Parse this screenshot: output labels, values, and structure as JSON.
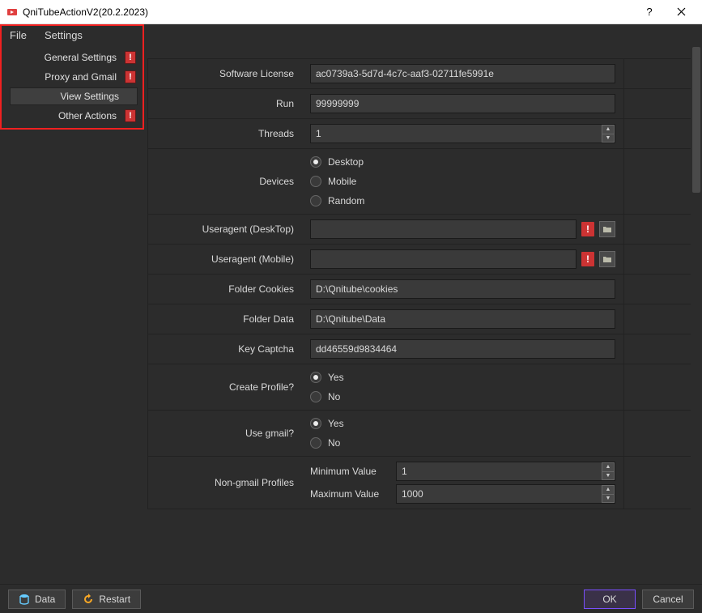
{
  "window": {
    "title": "QniTubeActionV2(20.2.2023)"
  },
  "menubar": {
    "file": "File",
    "settings": "Settings"
  },
  "sidebar": {
    "items": [
      {
        "label": "General Settings",
        "has_badge": true
      },
      {
        "label": "Proxy and Gmail",
        "has_badge": true
      },
      {
        "label": "View Settings",
        "has_badge": false,
        "selected": true
      },
      {
        "label": "Other Actions",
        "has_badge": true
      }
    ]
  },
  "form": {
    "license": {
      "label": "Software License",
      "value": "ac0739a3-5d7d-4c7c-aaf3-02711fe5991e"
    },
    "run": {
      "label": "Run",
      "value": "99999999"
    },
    "threads": {
      "label": "Threads",
      "value": "1"
    },
    "devices": {
      "label": "Devices",
      "options": [
        "Desktop",
        "Mobile",
        "Random"
      ],
      "selected": "Desktop"
    },
    "ua_desktop": {
      "label": "Useragent (DeskTop)",
      "value": ""
    },
    "ua_mobile": {
      "label": "Useragent  (Mobile)",
      "value": ""
    },
    "folder_cookies": {
      "label": "Folder Cookies",
      "value": "D:\\Qnitube\\cookies"
    },
    "folder_data": {
      "label": "Folder Data",
      "value": "D:\\Qnitube\\Data"
    },
    "key_captcha": {
      "label": "Key Captcha",
      "value": "dd46559d9834464"
    },
    "create_profile": {
      "label": "Create Profile?",
      "options": [
        "Yes",
        "No"
      ],
      "selected": "Yes"
    },
    "use_gmail": {
      "label": "Use gmail?",
      "options": [
        "Yes",
        "No"
      ],
      "selected": "Yes"
    },
    "non_gmail": {
      "label": "Non-gmail Profiles",
      "min_label": "Minimum Value",
      "min_value": "1",
      "max_label": "Maximum Value",
      "max_value": "1000"
    }
  },
  "footer": {
    "data": "Data",
    "restart": "Restart",
    "ok": "OK",
    "cancel": "Cancel"
  }
}
